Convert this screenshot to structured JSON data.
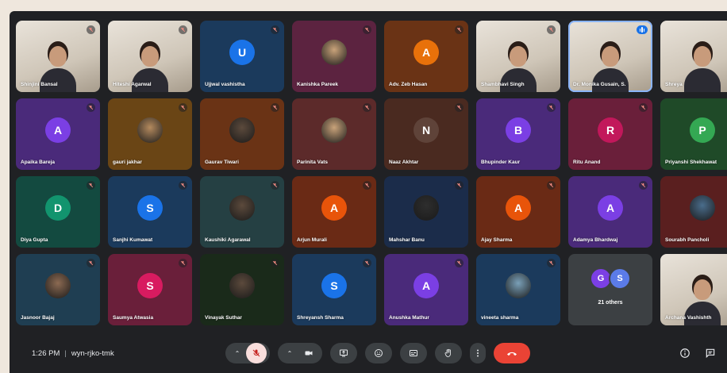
{
  "meeting": {
    "time": "1:26 PM",
    "code": "wyn-rjko-tmk",
    "separator": "|"
  },
  "colors": {
    "stage": "#202124",
    "mic_off": "#f28b82",
    "end_call": "#ea4335",
    "mic_button": "#f9dedc"
  },
  "participants": [
    {
      "name": "Shinjini Bansal",
      "type": "video",
      "muted": true
    },
    {
      "name": "Hiteshi Agarwal",
      "type": "video",
      "muted": true
    },
    {
      "name": "Ujjwal vashistha",
      "type": "initial",
      "initial": "U",
      "bg": "#1b3a5c",
      "color": "#1a73e8",
      "muted": true
    },
    {
      "name": "Kanishka Pareek",
      "type": "picture",
      "bg": "#5c2340",
      "muted": true
    },
    {
      "name": "Adv. Zeb Hasan",
      "type": "initial",
      "initial": "A",
      "bg": "#6a3315",
      "color": "#e8710a",
      "muted": true
    },
    {
      "name": "Shambhavi Singh",
      "type": "video",
      "muted": true
    },
    {
      "name": "Dr. Monika Gusain, S.",
      "type": "video",
      "speaking": true
    },
    {
      "name": "Shreya",
      "type": "video",
      "muted": false
    },
    {
      "name": "Apaika Bareja",
      "type": "initial",
      "initial": "A",
      "bg": "#4a2a7a",
      "color": "#7b3fe4",
      "muted": true
    },
    {
      "name": "gauri jakhar",
      "type": "picture",
      "bg": "#6a4515",
      "muted": true
    },
    {
      "name": "Gaurav Tiwari",
      "type": "picture",
      "bg": "#6a3315",
      "muted": true
    },
    {
      "name": "Parinita Vats",
      "type": "picture",
      "bg": "#5c2a2a",
      "muted": true
    },
    {
      "name": "Naaz Akhtar",
      "type": "initial",
      "initial": "N",
      "bg": "#4a2a20",
      "color": "#5f4339",
      "muted": true
    },
    {
      "name": "Bhupinder Kaur",
      "type": "initial",
      "initial": "B",
      "bg": "#4a2a7a",
      "color": "#7b3fe4",
      "muted": true
    },
    {
      "name": "Ritu Anand",
      "type": "initial",
      "initial": "R",
      "bg": "#6a1f3a",
      "color": "#c2185b",
      "muted": true
    },
    {
      "name": "Priyanshi Shekhawat",
      "type": "initial",
      "initial": "P",
      "bg": "#1f4a28",
      "color": "#34a853",
      "muted": false
    },
    {
      "name": "Diya Gupta",
      "type": "initial",
      "initial": "D",
      "bg": "#134a40",
      "color": "#12946e",
      "muted": true
    },
    {
      "name": "Sanjhi Kumawat",
      "type": "initial",
      "initial": "S",
      "bg": "#1b3a5c",
      "color": "#1a73e8",
      "muted": true
    },
    {
      "name": "Kaushiki Agarawal",
      "type": "picture",
      "bg": "#254043",
      "muted": true
    },
    {
      "name": "Arjun Murali",
      "type": "initial",
      "initial": "A",
      "bg": "#6a2a15",
      "color": "#e8540a",
      "muted": true
    },
    {
      "name": "Mahshar Banu",
      "type": "picture",
      "bg": "#1b2c4a",
      "muted": true
    },
    {
      "name": "Ajay Sharma",
      "type": "initial",
      "initial": "A",
      "bg": "#6a2a15",
      "color": "#e8540a",
      "muted": true
    },
    {
      "name": "Adamya Bhardwaj",
      "type": "initial",
      "initial": "A",
      "bg": "#4a2a7a",
      "color": "#7b3fe4",
      "muted": true
    },
    {
      "name": "Sourabh Pancholi",
      "type": "picture",
      "bg": "#5a1f1f",
      "muted": false
    },
    {
      "name": "Jasnoor Bajaj",
      "type": "picture",
      "bg": "#1f3e52",
      "muted": true
    },
    {
      "name": "Saumya Atwasia",
      "type": "initial",
      "initial": "S",
      "bg": "#6a1f3a",
      "color": "#d81b60",
      "muted": true
    },
    {
      "name": "Vinayak Suthar",
      "type": "picture",
      "bg": "#1a2a1a",
      "muted": true
    },
    {
      "name": "Shreyansh Sharma",
      "type": "initial",
      "initial": "S",
      "bg": "#1b3a5c",
      "color": "#1a73e8",
      "muted": true
    },
    {
      "name": "Anushka Mathur",
      "type": "initial",
      "initial": "A",
      "bg": "#4a2a7a",
      "color": "#7b3fe4",
      "muted": true
    },
    {
      "name": "vineeta sharma",
      "type": "picture",
      "bg": "#1b3a5c",
      "muted": true
    },
    {
      "name": "21 others",
      "type": "others",
      "avatars": [
        {
          "initial": "G",
          "color": "#7b3fe4"
        },
        {
          "initial": "S",
          "color": "#5b7be8"
        }
      ]
    },
    {
      "name": "Archana Vashishth",
      "type": "video",
      "muted": false
    }
  ],
  "icons": {
    "mic_off": "mic-off-icon",
    "camera": "camera-icon",
    "present": "present-icon",
    "emoji": "emoji-icon",
    "captions": "captions-icon",
    "raise_hand": "raise-hand-icon",
    "more": "more-options-icon",
    "end_call": "end-call-icon",
    "info": "info-icon",
    "chat": "chat-icon"
  }
}
